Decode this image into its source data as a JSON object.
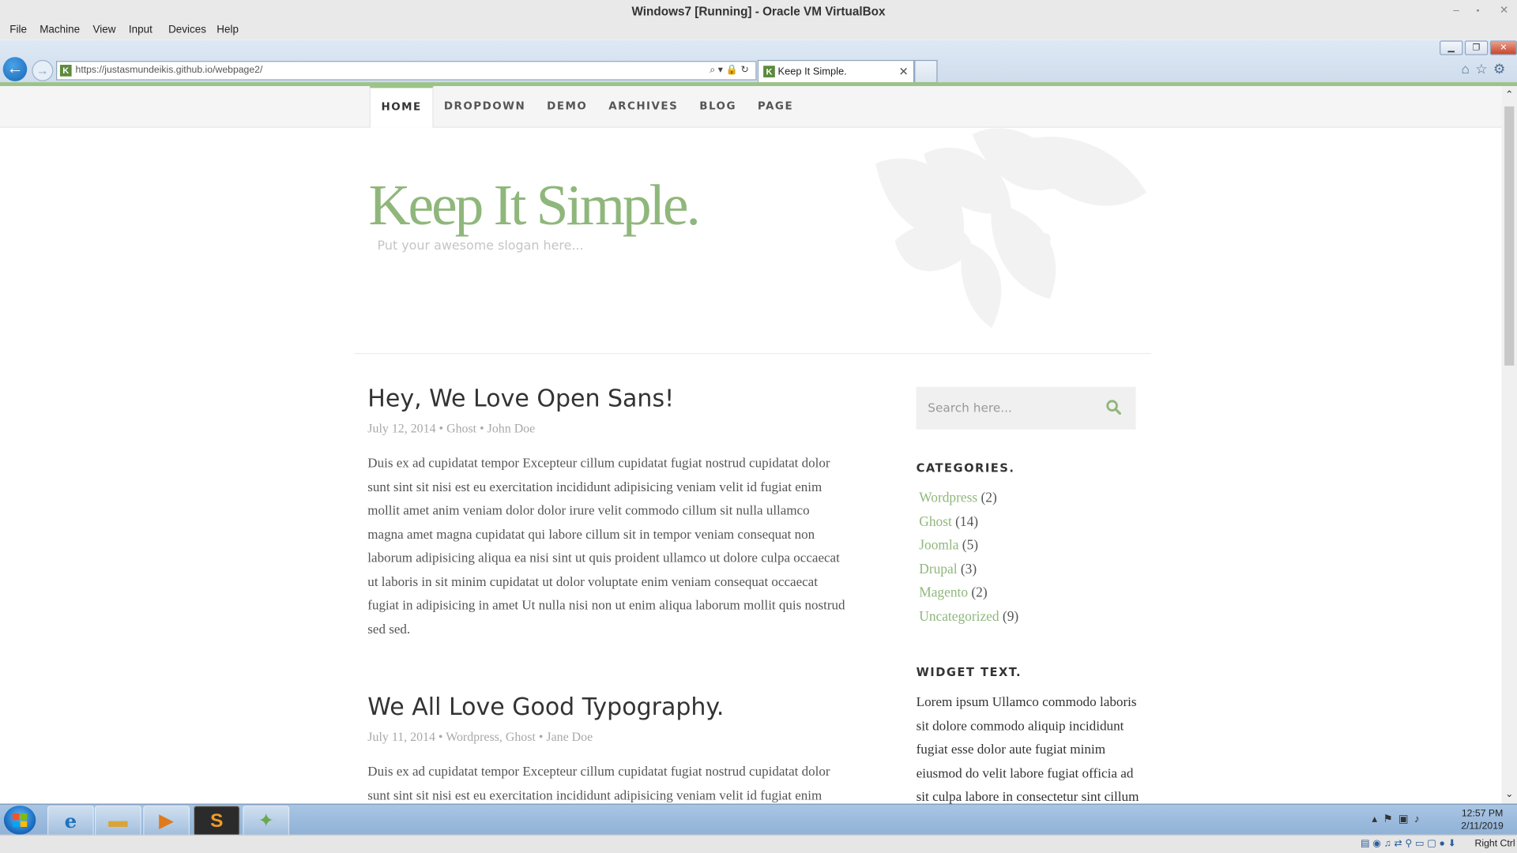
{
  "vbox": {
    "title": "Windows7 [Running] - Oracle VM VirtualBox",
    "menu": [
      "File",
      "Machine",
      "View",
      "Input",
      "Devices",
      "Help"
    ],
    "host_key": "Right Ctrl"
  },
  "browser": {
    "url": "https://justasmundeikis.github.io/webpage2/",
    "tab_title": "Keep It Simple.",
    "favicon_letter": "K"
  },
  "site": {
    "nav": [
      "HOME",
      "DROPDOWN",
      "DEMO",
      "ARCHIVES",
      "BLOG",
      "PAGE"
    ],
    "title": "Keep It Simple.",
    "slogan": "Put your awesome slogan here...",
    "posts": [
      {
        "title": "Hey, We Love Open Sans!",
        "meta": "July 12, 2014 • Ghost • John Doe",
        "body": "Duis ex ad cupidatat tempor Excepteur cillum cupidatat fugiat nostrud cupidatat dolor sunt sint sit nisi est eu exercitation incididunt adipisicing veniam velit id fugiat enim mollit amet anim veniam dolor dolor irure velit commodo cillum sit nulla ullamco magna amet magna cupidatat qui labore cillum sit in tempor veniam consequat non laborum adipisicing aliqua ea nisi sint ut quis proident ullamco ut dolore culpa occaecat ut laboris in sit minim cupidatat ut dolor voluptate enim veniam consequat occaecat fugiat in adipisicing in amet Ut nulla nisi non ut enim aliqua laborum mollit quis nostrud sed sed."
      },
      {
        "title": "We All Love Good Typography.",
        "meta": "July 11, 2014 • Wordpress, Ghost • Jane Doe",
        "body": "Duis ex ad cupidatat tempor Excepteur cillum cupidatat fugiat nostrud cupidatat dolor sunt sint sit nisi est eu exercitation incididunt adipisicing veniam velit id fugiat enim mollit amet anim veniam dolor dolor irure velit commodo cillum sit nulla ullamco magna amet magna cupidatat qui labore cillum sit in tempor"
      }
    ],
    "search_placeholder": "Search here...",
    "categories_title": "CATEGORIES.",
    "categories": [
      {
        "name": "Wordpress",
        "count": "(2)"
      },
      {
        "name": "Ghost",
        "count": "(14)"
      },
      {
        "name": "Joomla",
        "count": "(5)"
      },
      {
        "name": "Drupal",
        "count": "(3)"
      },
      {
        "name": "Magento",
        "count": "(2)"
      },
      {
        "name": "Uncategorized",
        "count": "(9)"
      }
    ],
    "widget_title": "WIDGET TEXT.",
    "widget_text": "Lorem ipsum Ullamco commodo laboris sit dolore commodo aliquip incididunt fugiat esse dolor aute fugiat minim eiusmod do velit labore fugiat officia ad sit culpa labore in consectetur sint cillum sint consectetur voluptate adipisicing"
  },
  "taskbar": {
    "time": "12:57 PM",
    "date": "2/11/2019"
  },
  "colors": {
    "accent_green": "#8fb77b",
    "taskbar": "#9bbbe0"
  }
}
